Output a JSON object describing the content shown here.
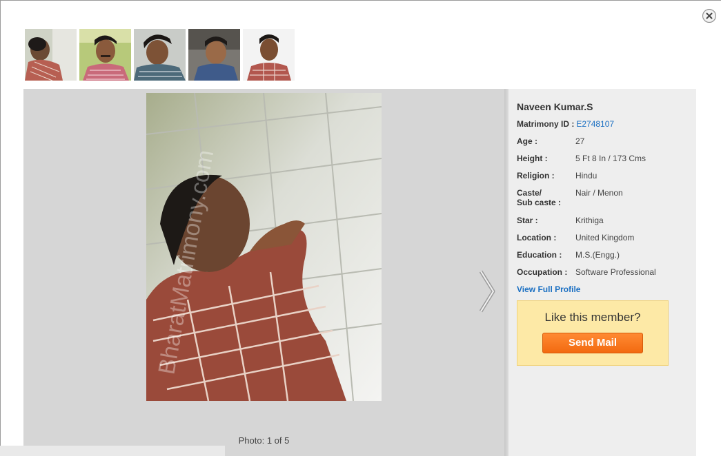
{
  "dialog": {
    "close_icon": "close-icon"
  },
  "thumbnails": [
    {
      "name": "thumb-photo-1"
    },
    {
      "name": "thumb-photo-2"
    },
    {
      "name": "thumb-photo-3"
    },
    {
      "name": "thumb-photo-4"
    },
    {
      "name": "thumb-photo-5"
    }
  ],
  "viewer": {
    "counter": "Photo: 1 of 5",
    "watermark": "BharatMatrimony.com",
    "next_icon": "chevron-right-icon"
  },
  "profile": {
    "name": "Naveen Kumar.S",
    "matrimony_id_label": "Matrimony ID :",
    "matrimony_id": "E2748107",
    "fields": [
      {
        "label": "Age :",
        "value": "27"
      },
      {
        "label": "Height :",
        "value": "5 Ft 8 In / 173 Cms"
      },
      {
        "label": "Religion :",
        "value": "Hindu"
      },
      {
        "label_line1": "Caste/",
        "label_line2": "Sub caste :",
        "value": "Nair / Menon"
      },
      {
        "label": "Star :",
        "value": "Krithiga"
      },
      {
        "label": "Location :",
        "value": "United Kingdom"
      },
      {
        "label": "Education :",
        "value": "M.S.(Engg.)"
      },
      {
        "label": "Occupation :",
        "value": "Software Professional"
      }
    ],
    "view_full_profile": "View Full Profile",
    "like_prompt": "Like this member?",
    "send_mail": "Send Mail"
  },
  "colors": {
    "link": "#1a6fc2",
    "accent": "#f26a10",
    "like_box_bg": "#fde9a6"
  }
}
